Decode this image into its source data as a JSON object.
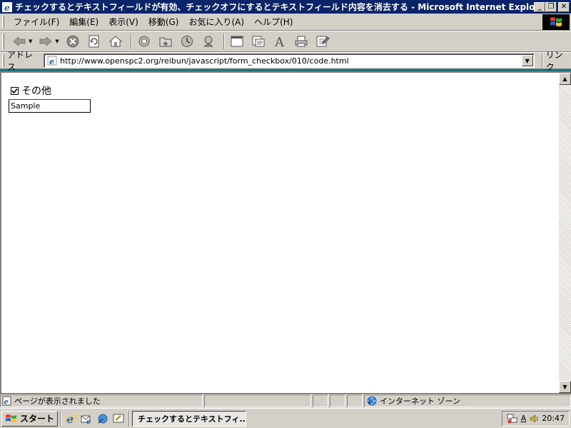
{
  "window": {
    "title": "チェックするとテキストフィールドが有効、チェックオフにするとテキストフィールド内容を消去する - Microsoft Internet Explorer",
    "minimize": "_",
    "maximize": "❐",
    "close": "✕"
  },
  "menu": {
    "items": [
      "ファイル(F)",
      "編集(E)",
      "表示(V)",
      "移動(G)",
      "お気に入り(A)",
      "ヘルプ(H)"
    ]
  },
  "address": {
    "label": "アドレス",
    "url": "http://www.openspc2.org/reibun/javascript/form_checkbox/010/code.html",
    "links_label": "リンク"
  },
  "page": {
    "checkbox_checked": true,
    "checkbox_label": "その他",
    "text_value": "Sample"
  },
  "status": {
    "message": "ページが表示されました",
    "zone": "インターネット ゾーン"
  },
  "taskbar": {
    "start_label": "スタート",
    "task_label": "チェックするとテキストフィ...",
    "clock": "20:47",
    "ime_label": "A"
  },
  "colors": {
    "titlebar": "#0a246a",
    "chrome": "#d4d0c8",
    "desktop": "#008080"
  }
}
